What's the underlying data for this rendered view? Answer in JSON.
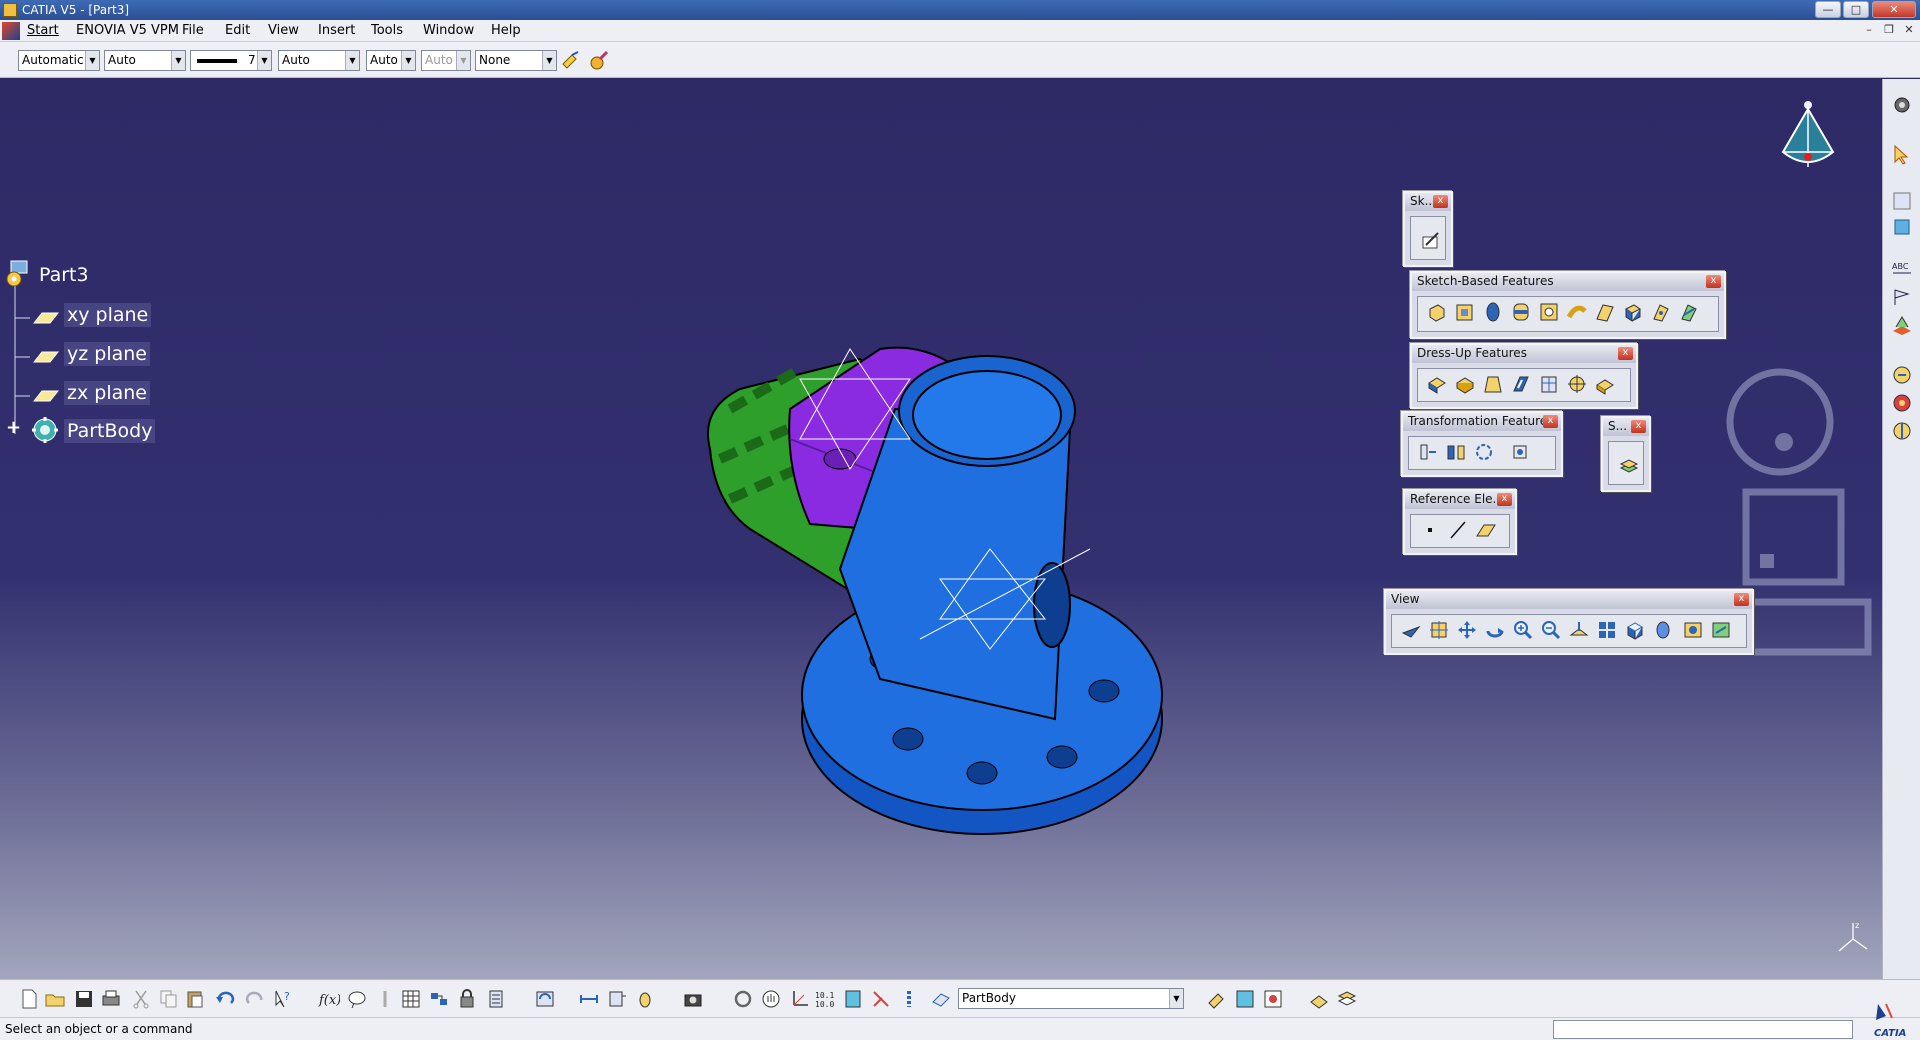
{
  "window": {
    "title": "CATIA V5 - [Part3]",
    "buttons": {
      "minimize": "—",
      "maximize": "□",
      "close": "✕"
    },
    "mdi_buttons": {
      "minimize": "–",
      "restore": "❐",
      "close": "✕"
    }
  },
  "menu": {
    "items": [
      {
        "label": "Start"
      },
      {
        "label": "ENOVIA V5 VPM"
      },
      {
        "label": "File"
      },
      {
        "label": "Edit"
      },
      {
        "label": "View"
      },
      {
        "label": "Insert"
      },
      {
        "label": "Tools"
      },
      {
        "label": "Window"
      },
      {
        "label": "Help"
      }
    ]
  },
  "graphic_properties": {
    "color": "Automatic",
    "transparency": "Auto",
    "line_weight": "7",
    "linetype": "Auto",
    "point_symbol": "Auto",
    "rendering_style": "Auto",
    "layer": "None",
    "painter_icon": "format-painter-icon",
    "properties_icon": "properties-icon"
  },
  "tree": {
    "root": "Part3",
    "children": [
      {
        "label": "xy plane",
        "icon": "plane-icon"
      },
      {
        "label": "yz plane",
        "icon": "plane-icon"
      },
      {
        "label": "zx plane",
        "icon": "plane-icon"
      },
      {
        "label": "PartBody",
        "icon": "body-icon"
      }
    ],
    "expander": "+"
  },
  "toolbars": {
    "sketcher": {
      "title": "Sk..."
    },
    "sketch_based": {
      "title": "Sketch-Based Features"
    },
    "dress_up": {
      "title": "Dress-Up Features"
    },
    "transformation": {
      "title": "Transformation Features"
    },
    "surface": {
      "title": "S..."
    },
    "reference": {
      "title": "Reference Ele..."
    },
    "view": {
      "title": "View"
    },
    "close_label": "x"
  },
  "bottom": {
    "current_body": "PartBody"
  },
  "status": {
    "message": "Select an object or a command"
  },
  "colors": {
    "background_top": "#2e2a66",
    "background_bottom": "#a3a6bd",
    "part_blue": "#1f6fe0",
    "part_green": "#2e9f2a",
    "part_purple": "#8a2be2"
  }
}
